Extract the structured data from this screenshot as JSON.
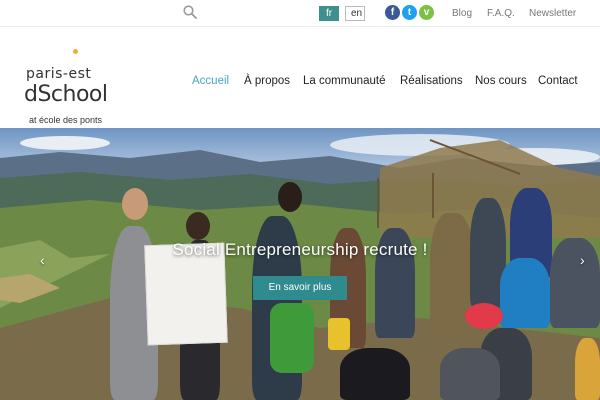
{
  "topbar": {
    "search_icon": "search-icon",
    "languages": [
      {
        "code": "fr",
        "active": true
      },
      {
        "code": "en",
        "active": false
      }
    ],
    "social": [
      {
        "name": "facebook-icon",
        "glyph": "f",
        "color": "#3b5998"
      },
      {
        "name": "twitter-icon",
        "glyph": "t",
        "color": "#1da1f2"
      },
      {
        "name": "viadeo-icon",
        "glyph": "v",
        "color": "#7cc242"
      }
    ],
    "links": [
      "Blog",
      "F.A.Q.",
      "Newsletter"
    ]
  },
  "logo": {
    "line1": "paris-est",
    "line2": "dSchool",
    "line3": "at école des ponts",
    "accent_color": "#e8b23a"
  },
  "nav": {
    "items": [
      "Accueil",
      "À propos",
      "La communauté",
      "Réalisations",
      "Nos cours",
      "Contact"
    ],
    "active_index": 0,
    "active_color": "#4aa7c2"
  },
  "hero": {
    "title": "Social Entrepreneurship recrute !",
    "button_label": "En savoir plus",
    "button_color": "#2f8b8d",
    "prev_arrow": "‹",
    "next_arrow": "›"
  }
}
